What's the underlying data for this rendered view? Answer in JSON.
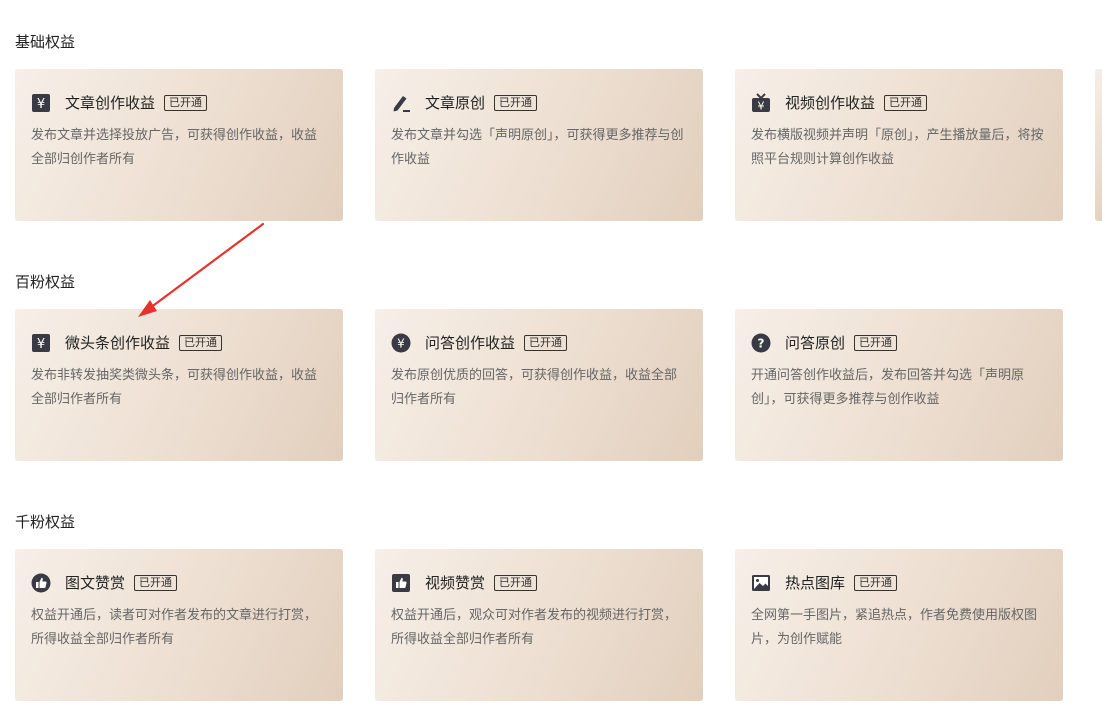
{
  "sections": [
    {
      "title": "基础权益",
      "cards": [
        {
          "icon": "yen-square-icon",
          "title": "文章创作收益",
          "badge": "已开通",
          "desc": "发布文章并选择投放广告，可获得创作收益，收益全部归创作者所有"
        },
        {
          "icon": "pen-icon",
          "title": "文章原创",
          "badge": "已开通",
          "desc": "发布文章并勾选「声明原创」，可获得更多推荐与创作收益"
        },
        {
          "icon": "tv-yen-icon",
          "title": "视频创作收益",
          "badge": "已开通",
          "desc": "发布横版视频并声明「原创」，产生播放量后，将按照平台规则计算创作收益"
        }
      ]
    },
    {
      "title": "百粉权益",
      "cards": [
        {
          "icon": "yen-square-icon",
          "title": "微头条创作收益",
          "badge": "已开通",
          "desc": "发布非转发抽奖类微头条，可获得创作收益，收益全部归作者所有"
        },
        {
          "icon": "yen-circle-icon",
          "title": "问答创作收益",
          "badge": "已开通",
          "desc": "发布原创优质的回答，可获得创作收益，收益全部归作者所有"
        },
        {
          "icon": "question-circle-icon",
          "title": "问答原创",
          "badge": "已开通",
          "desc": "开通问答创作收益后，发布回答并勾选「声明原创」，可获得更多推荐与创作收益"
        }
      ]
    },
    {
      "title": "千粉权益",
      "cards": [
        {
          "icon": "thumbs-up-circle-icon",
          "title": "图文赞赏",
          "badge": "已开通",
          "desc": "权益开通后，读者可对作者发布的文章进行打赏，所得收益全部归作者所有"
        },
        {
          "icon": "thumbs-up-square-icon",
          "title": "视频赞赏",
          "badge": "已开通",
          "desc": "权益开通后，观众可对作者发布的视频进行打赏，所得收益全部归作者所有"
        },
        {
          "icon": "picture-icon",
          "title": "热点图库",
          "badge": "已开通",
          "desc": "全网第一手图片，紧追热点，作者免费使用版权图片，为创作赋能"
        }
      ]
    }
  ],
  "colors": {
    "icon_dark": "#3a3a44",
    "arrow_red": "#e8322c"
  }
}
